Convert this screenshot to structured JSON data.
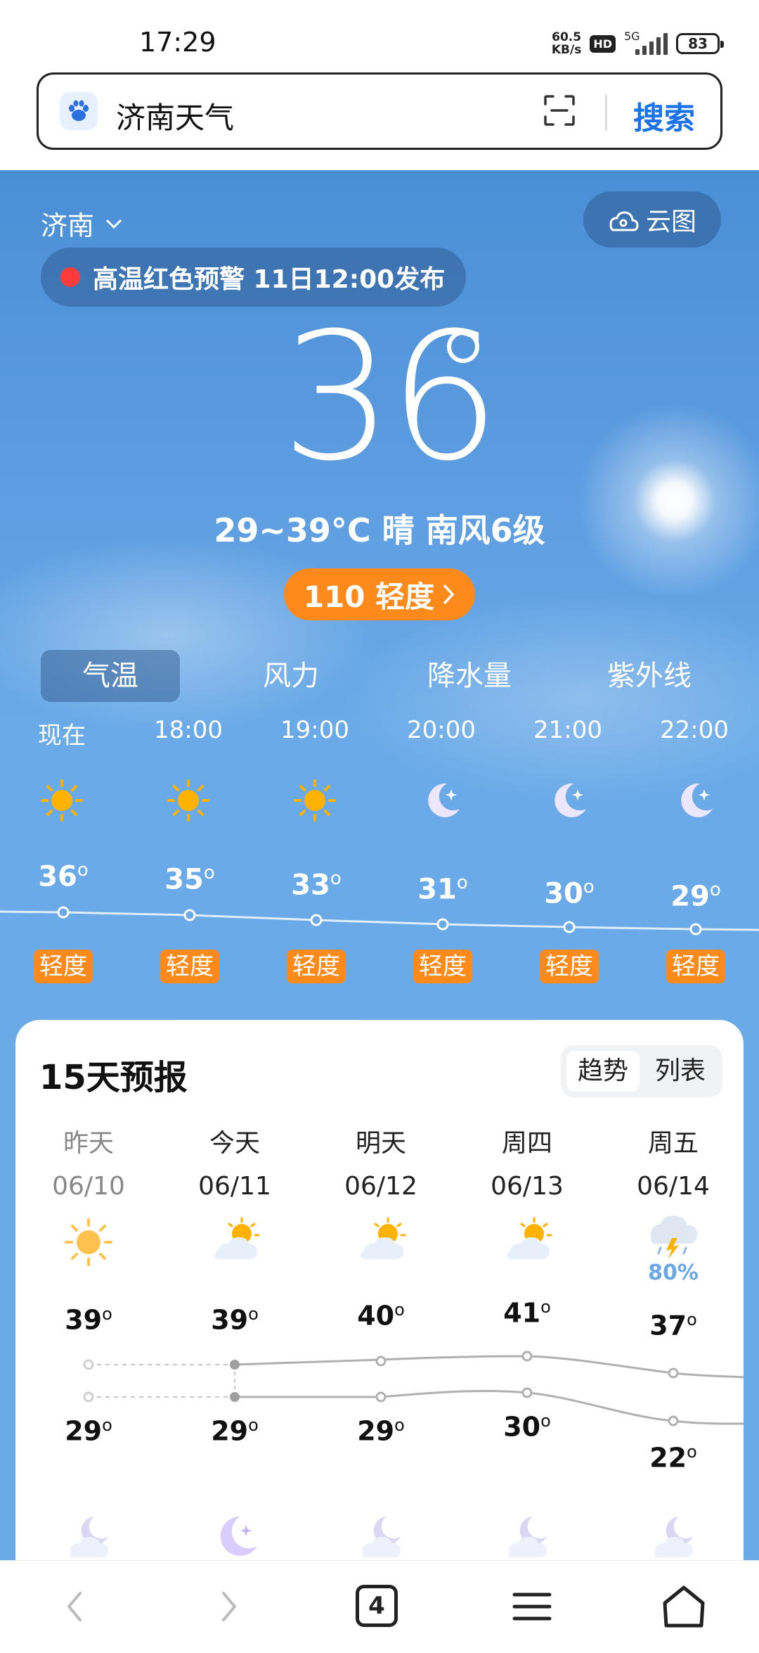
{
  "status_bar": {
    "time": "17:29",
    "net_speed_value": "60.5",
    "net_speed_unit": "KB/s",
    "hd": "HD",
    "network": "5G",
    "battery": "83"
  },
  "search": {
    "query": "济南天气",
    "button": "搜索"
  },
  "weather": {
    "city": "济南",
    "cloud_map": "云图",
    "alert": "高温红色预警 11日12:00发布",
    "current_temp": "36",
    "summary": "29~39°C  晴  南风6级",
    "aqi": "110 轻度",
    "tabs": [
      "气温",
      "风力",
      "降水量",
      "紫外线"
    ],
    "active_tab": "气温",
    "hourly": [
      {
        "time": "现在",
        "icon": "sun-icon",
        "temp": "36",
        "quality": "轻度"
      },
      {
        "time": "18:00",
        "icon": "sun-icon",
        "temp": "35",
        "quality": "轻度"
      },
      {
        "time": "19:00",
        "icon": "sun-icon",
        "temp": "33",
        "quality": "轻度"
      },
      {
        "time": "20:00",
        "icon": "moon-icon",
        "temp": "31",
        "quality": "轻度"
      },
      {
        "time": "21:00",
        "icon": "moon-icon",
        "temp": "30",
        "quality": "轻度"
      },
      {
        "time": "22:00",
        "icon": "moon-icon",
        "temp": "29",
        "quality": "轻度"
      }
    ]
  },
  "forecast": {
    "title": "15天预报",
    "toggle": [
      "趋势",
      "列表"
    ],
    "active_toggle": "趋势",
    "days": [
      {
        "name": "昨天",
        "date": "06/10",
        "icon": "sun-icon",
        "high": "39",
        "low": "29",
        "night_icon": "cloudy-moon-icon"
      },
      {
        "name": "今天",
        "date": "06/11",
        "icon": "partly-cloudy-icon",
        "high": "39",
        "low": "29",
        "night_icon": "clear-moon-icon"
      },
      {
        "name": "明天",
        "date": "06/12",
        "icon": "partly-cloudy-icon",
        "high": "40",
        "low": "29",
        "night_icon": "cloudy-moon-icon"
      },
      {
        "name": "周四",
        "date": "06/13",
        "icon": "partly-cloudy-icon",
        "high": "41",
        "low": "30",
        "night_icon": "cloudy-moon-icon"
      },
      {
        "name": "周五",
        "date": "06/14",
        "icon": "thunderstorm-icon",
        "precip": "80%",
        "high": "37",
        "low": "22",
        "night_icon": "cloudy-moon-icon"
      }
    ]
  },
  "nav": {
    "tabs_count": "4"
  },
  "colors": {
    "accent_blue": "#1a73e8",
    "aqi_orange": "#ff8a1c",
    "alert_red": "#ff3b3b"
  }
}
